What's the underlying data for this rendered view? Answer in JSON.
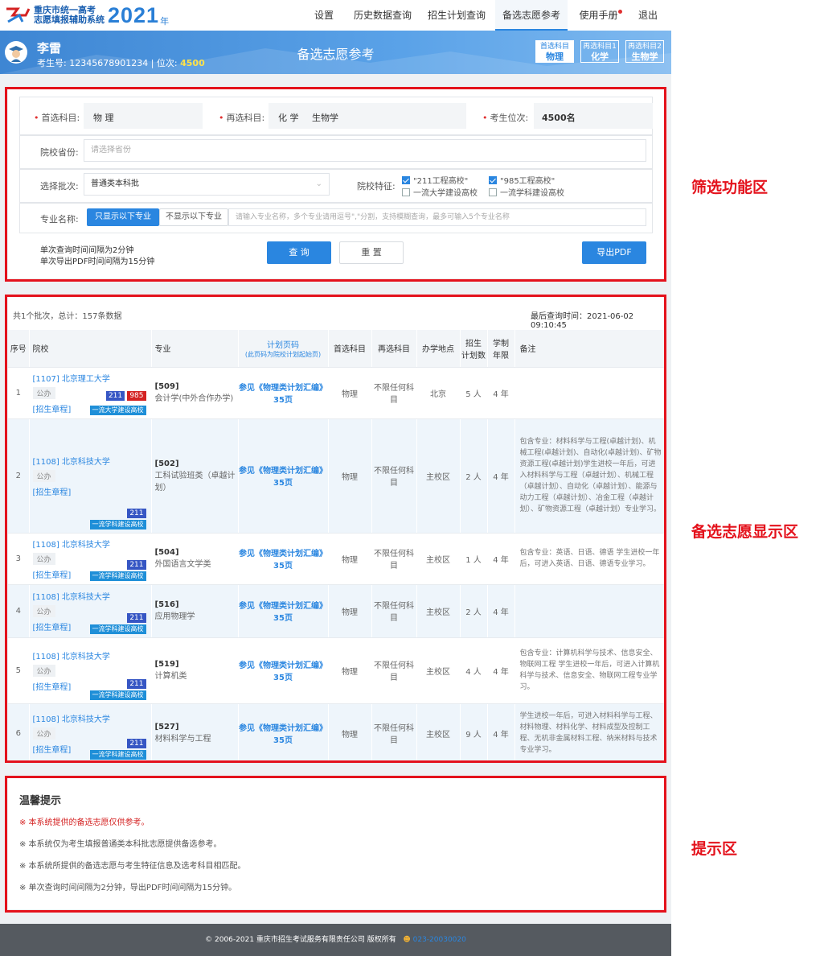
{
  "logo": {
    "line1": "重庆市统一高考",
    "line2": "志愿填报辅助系统",
    "year": "2021",
    "nian": "年"
  },
  "nav": [
    "设置",
    "历史数据查询",
    "招生计划查询",
    "备选志愿参考",
    "使用手册",
    "退出"
  ],
  "header": {
    "name": "李雷",
    "examno_label": "考生号:",
    "examno": "12345678901234",
    "rank_label": "| 位次:",
    "rank": "4500",
    "title": "备选志愿参考",
    "subjects": [
      {
        "t": "首选科目",
        "v": "物理"
      },
      {
        "t": "再选科目1",
        "v": "化学"
      },
      {
        "t": "再选科目2",
        "v": "生物学"
      }
    ]
  },
  "filter": {
    "first_label": "首选科目:",
    "first_value": "物 理",
    "second_label": "再选科目:",
    "second_v1": "化 学",
    "second_v2": "生物学",
    "rank_label": "考生位次:",
    "rank_value": "4500名",
    "province_label": "院校省份:",
    "province_placeholder": "请选择省份",
    "batch_label": "选择批次:",
    "batch_value": "普通类本科批",
    "feature_label": "院校特征:",
    "features": [
      {
        "text": "\"211工程高校\"",
        "on": true
      },
      {
        "text": "\"985工程高校\"",
        "on": true
      },
      {
        "text": "一流大学建设高校",
        "on": false
      },
      {
        "text": "一流学科建设高校",
        "on": false
      }
    ],
    "major_label": "专业名称:",
    "major_btn_on": "只显示以下专业",
    "major_btn_off": "不显示以下专业",
    "major_placeholder": "请输入专业名称，多个专业请用逗号\",\"分割，支持模糊查询，最多可输入5个专业名称",
    "note1": "单次查询时间间隔为2分钟",
    "note2": "单次导出PDF时间间隔为15分钟",
    "query": "查 询",
    "reset": "重 置",
    "export": "导出PDF"
  },
  "result": {
    "summary": "共1个批次，总计：157条数据",
    "last_time": "最后查询时间：2021-06-02 09:10:45",
    "headers": {
      "no": "序号",
      "school": "院校",
      "major": "专业",
      "plan1": "计划页码",
      "plan2": "(此页码为院校计划起始页)",
      "first": "首选科目",
      "second": "再选科目",
      "loc": "办学地点",
      "count1": "招生",
      "count2": "计划数",
      "years1": "学制",
      "years2": "年限",
      "note": "备注"
    },
    "rows": [
      {
        "no": "1",
        "school": "[1107] 北京理工大学",
        "type": "公办",
        "link": "[招生章程]",
        "b211": "211",
        "b985": "985",
        "line": "一流大学建设高校",
        "mcode": "[509]",
        "mname": "会计学(中外合作办学)",
        "plan": "参见《物理类计划汇编》35页",
        "first": "物理",
        "second": "不限任何科目",
        "loc": "北京",
        "count": "5 人",
        "years": "4 年",
        "note": ""
      },
      {
        "no": "2",
        "school": "[1108] 北京科技大学",
        "type": "公办",
        "link": "[招生章程]",
        "b211": "211",
        "b985": "",
        "line": "一流学科建设高校",
        "mcode": "[502]",
        "mname": "工科试验班类（卓越计划）",
        "plan": "参见《物理类计划汇编》35页",
        "first": "物理",
        "second": "不限任何科目",
        "loc": "主校区",
        "count": "2 人",
        "years": "4 年",
        "note": "包含专业：材料科学与工程(卓越计划)、机械工程(卓越计划)、自动化(卓越计划)、矿物资源工程(卓越计划)学生进校一年后，可进入材料科学与工程（卓越计划）、机械工程（卓越计划）、自动化（卓越计划）、能源与动力工程（卓越计划）、冶金工程（卓越计划）、矿物资源工程（卓越计划）专业学习。"
      },
      {
        "no": "3",
        "school": "[1108] 北京科技大学",
        "type": "公办",
        "link": "[招生章程]",
        "b211": "211",
        "b985": "",
        "line": "一流学科建设高校",
        "mcode": "[504]",
        "mname": "外国语言文学类",
        "plan": "参见《物理类计划汇编》35页",
        "first": "物理",
        "second": "不限任何科目",
        "loc": "主校区",
        "count": "1 人",
        "years": "4 年",
        "note": "包含专业：英语、日语、德语 学生进校一年后，可进入英语、日语、德语专业学习。"
      },
      {
        "no": "4",
        "school": "[1108] 北京科技大学",
        "type": "公办",
        "link": "[招生章程]",
        "b211": "211",
        "b985": "",
        "line": "一流学科建设高校",
        "mcode": "[516]",
        "mname": "应用物理学",
        "plan": "参见《物理类计划汇编》35页",
        "first": "物理",
        "second": "不限任何科目",
        "loc": "主校区",
        "count": "2 人",
        "years": "4 年",
        "note": ""
      },
      {
        "no": "5",
        "school": "[1108] 北京科技大学",
        "type": "公办",
        "link": "[招生章程]",
        "b211": "211",
        "b985": "",
        "line": "一流学科建设高校",
        "mcode": "[519]",
        "mname": "计算机类",
        "plan": "参见《物理类计划汇编》35页",
        "first": "物理",
        "second": "不限任何科目",
        "loc": "主校区",
        "count": "4 人",
        "years": "4 年",
        "note": "包含专业：计算机科学与技术、信息安全、物联网工程 学生进校一年后，可进入计算机科学与技术、信息安全、物联网工程专业学习。"
      },
      {
        "no": "6",
        "school": "[1108] 北京科技大学",
        "type": "公办",
        "link": "[招生章程]",
        "b211": "211",
        "b985": "",
        "line": "一流学科建设高校",
        "mcode": "[527]",
        "mname": "材料科学与工程",
        "plan": "参见《物理类计划汇编》35页",
        "first": "物理",
        "second": "不限任何科目",
        "loc": "主校区",
        "count": "9 人",
        "years": "4 年",
        "note": "学生进校一年后，可进入材料科学与工程、材料物理、材料化学、材料成型及控制工程、无机非金属材料工程、纳米材料与技术专业学习。"
      }
    ]
  },
  "tips": {
    "title": "温馨提示",
    "items": [
      "※  本系统提供的备选志愿仅供参考。",
      "※  本系统仅为考生填报普通类本科批志愿提供备选参考。",
      "※  本系统所提供的备选志愿与考生特征信息及选考科目相匹配。",
      "※  单次查询时间间隔为2分钟，导出PDF时间间隔为15分钟。"
    ]
  },
  "footer": {
    "text": "© 2006-2021 重庆市招生考试服务有限责任公司 版权所有",
    "phone": "023-20030020"
  },
  "annotations": {
    "filter": "筛选功能区",
    "display": "备选志愿显示区",
    "tips": "提示区"
  },
  "colors": {
    "accent": "#2a86e0",
    "annotation_red": "#e4121c",
    "header_blue": "#3e86d3"
  }
}
